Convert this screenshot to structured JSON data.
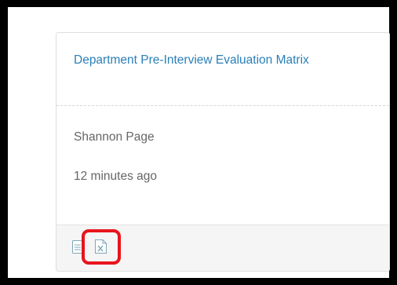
{
  "card": {
    "title": "Department Pre-Interview Evaluation Matrix",
    "author": "Shannon Page",
    "time": "12 minutes ago"
  },
  "footer": {
    "icons": [
      "document-icon",
      "excel-icon"
    ],
    "highlighted": "excel-icon"
  },
  "colors": {
    "link": "#2a7fb8",
    "muted_text": "#666666",
    "icon": "#7fa6b8",
    "highlight": "#e8141c"
  }
}
